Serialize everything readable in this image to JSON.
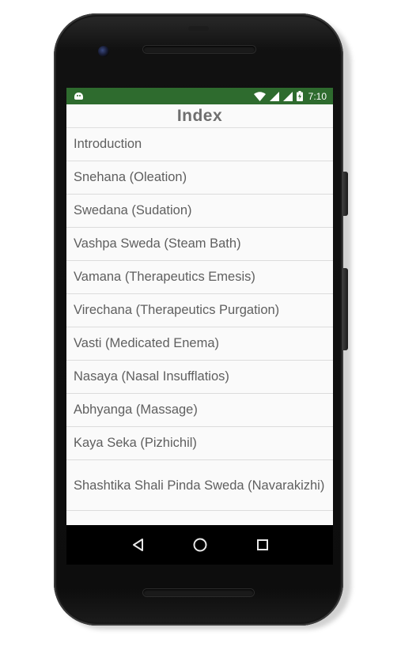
{
  "status_bar": {
    "time": "7:10",
    "icons": [
      "android-notification-icon",
      "wifi-icon",
      "signal-icon",
      "signal-icon",
      "battery-charging-icon"
    ],
    "color": "#2e6b2e"
  },
  "app_bar": {
    "title": "Index"
  },
  "index_items": [
    {
      "label": "Introduction"
    },
    {
      "label": "Snehana (Oleation)"
    },
    {
      "label": "Swedana (Sudation)"
    },
    {
      "label": "Vashpa Sweda (Steam Bath)"
    },
    {
      "label": "Vamana (Therapeutics Emesis)"
    },
    {
      "label": "Virechana (Therapeutics Purgation)"
    },
    {
      "label": "Vasti (Medicated Enema)"
    },
    {
      "label": "Nasaya (Nasal Insufflatios)"
    },
    {
      "label": "Abhyanga (Massage)"
    },
    {
      "label": "Kaya Seka (Pizhichil)"
    },
    {
      "label": "Shashtika Shali Pinda Sweda (Navarakizhi)"
    }
  ],
  "nav_bar": {
    "icons": [
      "back-icon",
      "home-icon",
      "recents-icon"
    ]
  }
}
